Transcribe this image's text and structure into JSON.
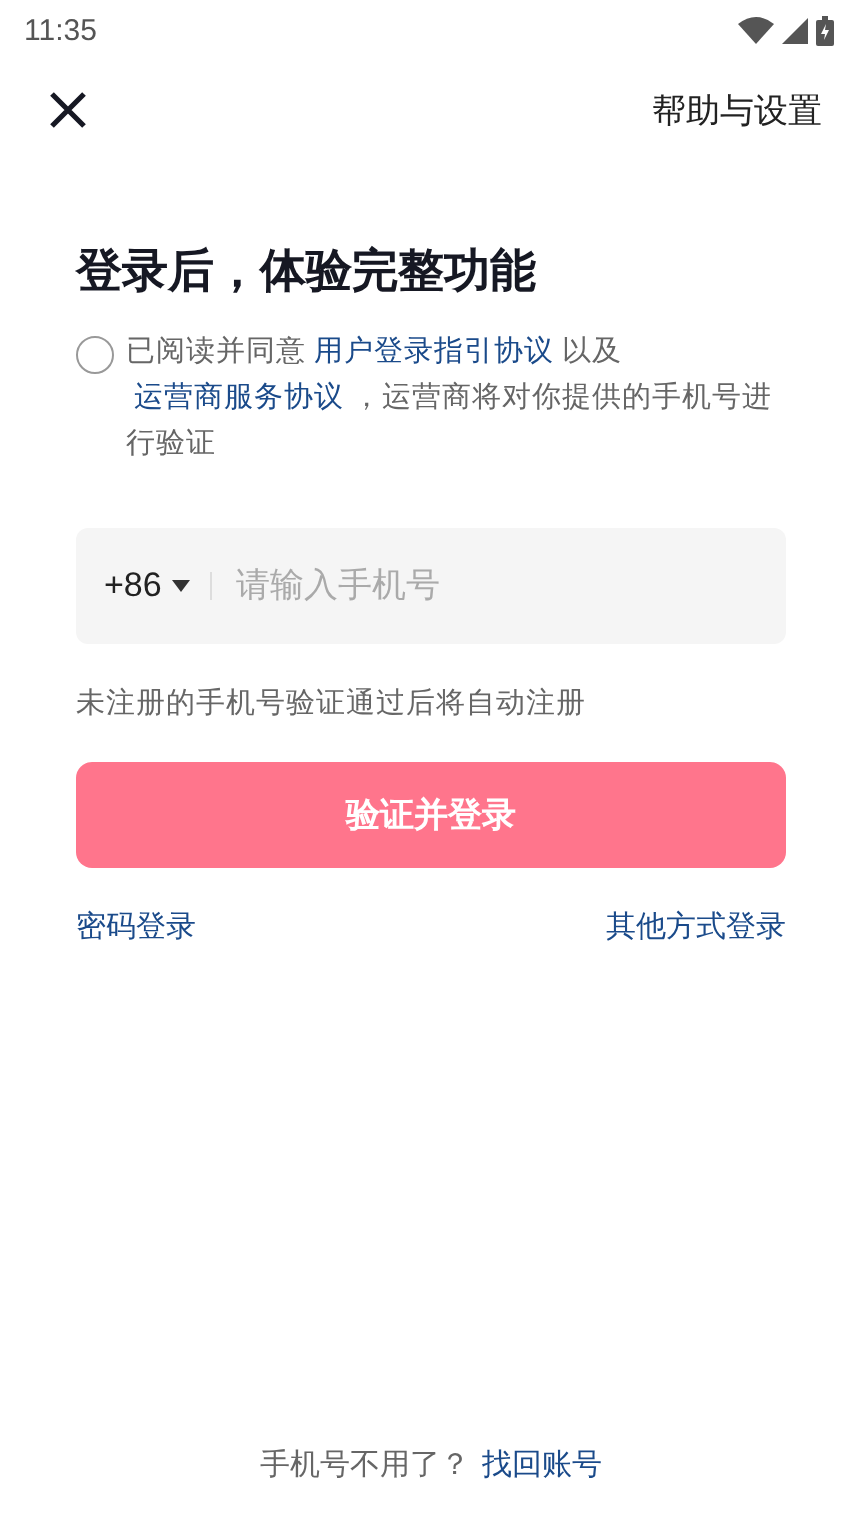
{
  "status_bar": {
    "time": "11:35"
  },
  "header": {
    "action": "帮助与设置"
  },
  "title": "登录后，体验完整功能",
  "agreement": {
    "checked": false,
    "parts": [
      {
        "kind": "text",
        "text": "已阅读并同意"
      },
      {
        "kind": "link",
        "text": "用户登录指引协议"
      },
      {
        "kind": "text",
        "text": "以及"
      },
      {
        "kind": "link",
        "text": "运营商服务协议"
      },
      {
        "kind": "text",
        "text": "，运营商将对你提供的手机号进行验证"
      }
    ]
  },
  "phone": {
    "country_code": "+86",
    "placeholder": "请输入手机号"
  },
  "hint": "未注册的手机号验证通过后将自动注册",
  "submit": "验证并登录",
  "links": [
    "密码登录",
    "其他方式登录"
  ],
  "footer": {
    "text": "手机号不用了？",
    "link": "找回账号"
  }
}
